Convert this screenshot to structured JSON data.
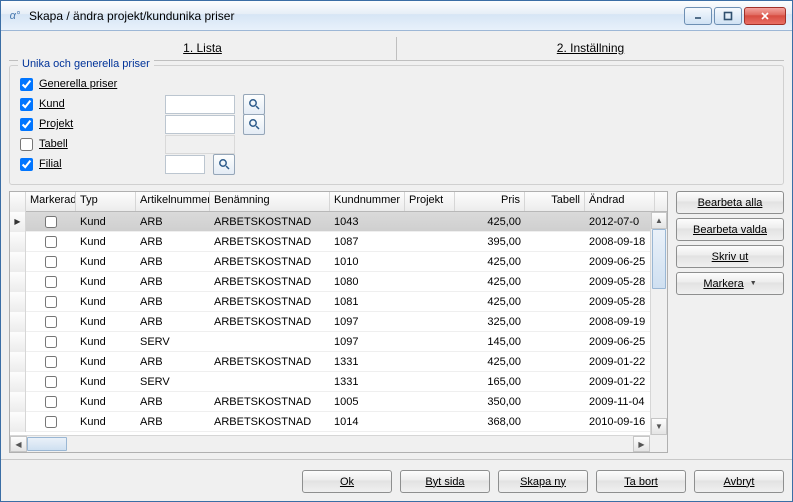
{
  "window": {
    "title": "Skapa / ändra projekt/kundunika priser"
  },
  "tabs": {
    "lista": "1. Lista",
    "inst": "2. Inställning"
  },
  "group": {
    "legend": "Unika och generella priser",
    "generella": "Generella priser",
    "kund": "Kund",
    "projekt": "Projekt",
    "tabell": "Tabell",
    "filial": "Filial"
  },
  "grid": {
    "headers": {
      "markerad": "Markerad",
      "typ": "Typ",
      "artikelnr": "Artikelnummer",
      "benamning": "Benämning",
      "kundnr": "Kundnummer",
      "projekt": "Projekt",
      "pris": "Pris",
      "tabell": "Tabell",
      "andrad": "Ändrad"
    },
    "rows": [
      {
        "typ": "Kund",
        "art": "ARB",
        "ben": "ARBETSKOSTNAD",
        "kn": "1043",
        "proj": "",
        "pris": "425,00",
        "tab": "",
        "andr": "2012-07-0",
        "sel": true
      },
      {
        "typ": "Kund",
        "art": "ARB",
        "ben": "ARBETSKOSTNAD",
        "kn": "1087",
        "proj": "",
        "pris": "395,00",
        "tab": "",
        "andr": "2008-09-18"
      },
      {
        "typ": "Kund",
        "art": "ARB",
        "ben": "ARBETSKOSTNAD",
        "kn": "1010",
        "proj": "",
        "pris": "425,00",
        "tab": "",
        "andr": "2009-06-25"
      },
      {
        "typ": "Kund",
        "art": "ARB",
        "ben": "ARBETSKOSTNAD",
        "kn": "1080",
        "proj": "",
        "pris": "425,00",
        "tab": "",
        "andr": "2009-05-28"
      },
      {
        "typ": "Kund",
        "art": "ARB",
        "ben": "ARBETSKOSTNAD",
        "kn": "1081",
        "proj": "",
        "pris": "425,00",
        "tab": "",
        "andr": "2009-05-28"
      },
      {
        "typ": "Kund",
        "art": "ARB",
        "ben": "ARBETSKOSTNAD",
        "kn": "1097",
        "proj": "",
        "pris": "325,00",
        "tab": "",
        "andr": "2008-09-19"
      },
      {
        "typ": "Kund",
        "art": "SERV",
        "ben": "",
        "kn": "1097",
        "proj": "",
        "pris": "145,00",
        "tab": "",
        "andr": "2009-06-25"
      },
      {
        "typ": "Kund",
        "art": "ARB",
        "ben": "ARBETSKOSTNAD",
        "kn": "1331",
        "proj": "",
        "pris": "425,00",
        "tab": "",
        "andr": "2009-01-22"
      },
      {
        "typ": "Kund",
        "art": "SERV",
        "ben": "",
        "kn": "1331",
        "proj": "",
        "pris": "165,00",
        "tab": "",
        "andr": "2009-01-22"
      },
      {
        "typ": "Kund",
        "art": "ARB",
        "ben": "ARBETSKOSTNAD",
        "kn": "1005",
        "proj": "",
        "pris": "350,00",
        "tab": "",
        "andr": "2009-11-04"
      },
      {
        "typ": "Kund",
        "art": "ARB",
        "ben": "ARBETSKOSTNAD",
        "kn": "1014",
        "proj": "",
        "pris": "368,00",
        "tab": "",
        "andr": "2010-09-16"
      }
    ]
  },
  "sidebar": {
    "bearbeta_alla": "Bearbeta alla",
    "bearbeta_valda": "Bearbeta valda",
    "skriv_ut": "Skriv ut",
    "markera": "Markera"
  },
  "footer": {
    "ok": "Ok",
    "byt_sida": "Byt sida",
    "skapa_ny": "Skapa ny",
    "ta_bort": "Ta bort",
    "avbryt": "Avbryt"
  }
}
